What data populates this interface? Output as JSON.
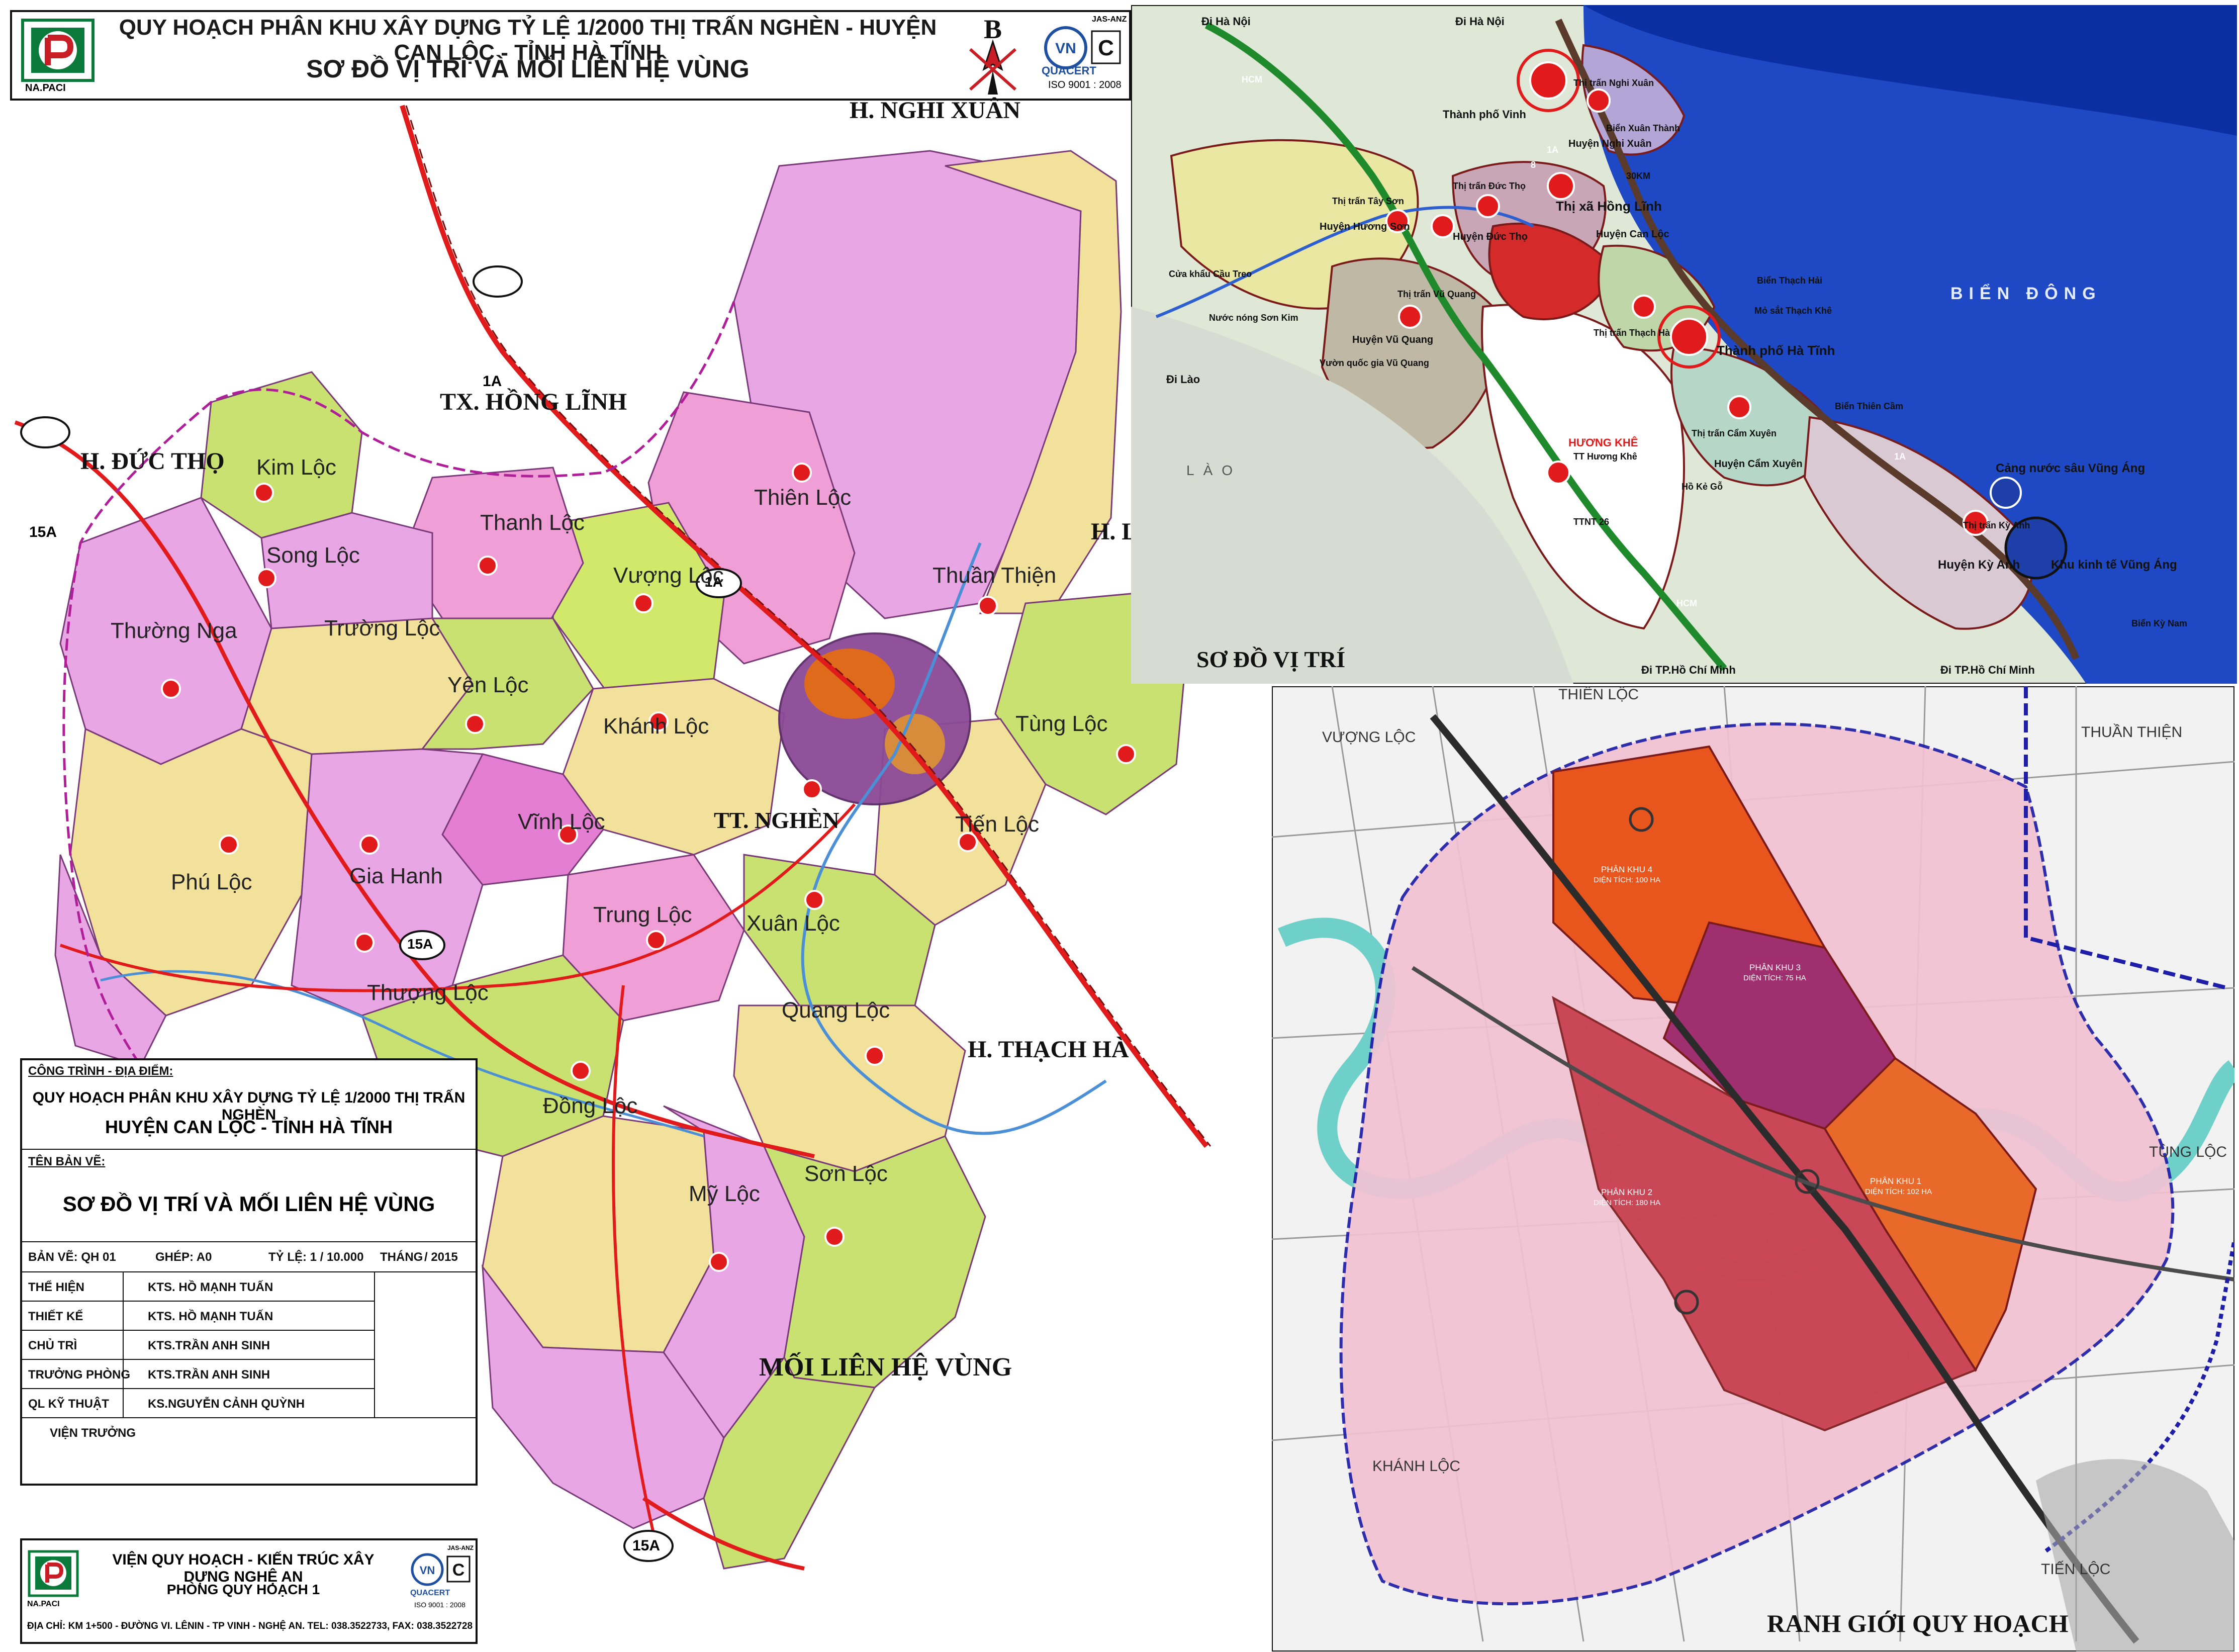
{
  "header": {
    "title_line1": "QUY HOẠCH PHÂN KHU XÂY DỰNG TỶ LỆ 1/2000 THỊ TRẤN NGHÈN - HUYỆN CAN LỘC - TỈNH HÀ TĨNH",
    "title_line2": "SƠ ĐỒ VỊ TRÍ VÀ MỐI LIÊN HỆ VÙNG",
    "logo_caption": "NA.PACI",
    "cert_label": "QUACERT",
    "cert_iso": "ISO 9001 : 2008",
    "cert_jas": "JAS-ANZ",
    "north_letter": "B"
  },
  "main_map": {
    "neighbors": [
      "H. NGHI XUÂN",
      "TX. HỒNG LĨNH",
      "H. ĐỨC THỌ",
      "H. THẠCH HÀ",
      "H. L"
    ],
    "section_title": "MỐI LIÊN HỆ VÙNG",
    "road_labels": [
      "1A",
      "1A",
      "15A",
      "15A",
      "15A"
    ],
    "communes": [
      "Kim Lộc",
      "Song Lộc",
      "Thường Nga",
      "Trường Lộc",
      "Thanh Lộc",
      "Thiên Lộc",
      "Vượng Lộc",
      "Yên Lộc",
      "Khánh Lộc",
      "Thuần Thiện",
      "Tùng Lộc",
      "Vĩnh Lộc",
      "TT. NGHÈN",
      "Tiến Lộc",
      "Phú Lộc",
      "Gia Hanh",
      "Trung Lộc",
      "Xuân Lộc",
      "Thượng Lộc",
      "Quang Lộc",
      "Đồng Lộc",
      "Mỹ Lộc",
      "Sơn Lộc"
    ]
  },
  "title_block": {
    "project_label": "CÔNG TRÌNH - ĐỊA ĐIỂM:",
    "project_line1": "QUY HOẠCH PHÂN KHU XÂY DỰNG TỶ LỆ 1/2000 THỊ TRẤN NGHÈN",
    "project_line2": "HUYỆN CAN LỘC - TỈNH HÀ TĨNH",
    "drawing_label": "TÊN BẢN VẼ:",
    "drawing_name": "SƠ ĐỒ VỊ TRÍ VÀ MỐI LIÊN HỆ VÙNG",
    "sheet": "BẢN VẼ: QH 01",
    "ghep": "GHÉP: A0",
    "scale": "TỶ LỆ: 1 / 10.000",
    "date_month": "THÁNG",
    "date_year": "/ 2015",
    "rows": [
      {
        "role": "THỂ HIỆN",
        "name": "KTS. HỒ MẠNH TUẤN"
      },
      {
        "role": "THIẾT KẾ",
        "name": "KTS. HỒ MẠNH TUẤN"
      },
      {
        "role": "CHỦ TRÌ",
        "name": "KTS.TRẦN ANH SINH"
      },
      {
        "role": "TRƯỞNG PHÒNG",
        "name": "KTS.TRẦN ANH SINH"
      },
      {
        "role": "QL KỸ THUẬT",
        "name": "KS.NGUYỄN CẢNH QUỲNH"
      }
    ],
    "director": "VIỆN TRƯỞNG"
  },
  "footer": {
    "org_line1": "VIỆN QUY HOẠCH - KIẾN TRÚC XÂY DỰNG NGHỆ AN",
    "org_line2": "PHÒNG QUY HOẠCH 1",
    "address": "ĐỊA CHỈ: KM 1+500 - ĐƯỜNG VI. LÊNIN - TP VINH - NGHỆ AN. TEL: 038.3522733, FAX: 038.3522728",
    "logo_caption": "NA.PACI",
    "cert_label": "QUACERT",
    "cert_iso": "ISO 9001 : 2008",
    "cert_jas": "JAS-ANZ"
  },
  "inset_location": {
    "title": "SƠ ĐỒ VỊ TRÍ",
    "sea_label": "BIỂN ĐÔNG",
    "laos_label": "LÀO",
    "places": [
      "Đi Hà Nội",
      "Đi Hà Nội",
      "Thành phố Vinh",
      "Thị trấn Nghi Xuân",
      "Biển Xuân Thành",
      "Huyện Nghi Xuân",
      "Thị xã Hồng Lĩnh",
      "Huyện Can Lộc",
      "Thị trấn Đức Thọ",
      "Huyện Đức Thọ",
      "Thị trấn Tây Sơn",
      "Huyện Hương Sơn",
      "Cửa khẩu Cầu Treo",
      "Nước nóng Sơn Kim",
      "Đi Lào",
      "Thị trấn Vũ Quang",
      "Huyện Vũ Quang",
      "Vườn quốc gia Vũ Quang",
      "Thị trấn Thạch Hà",
      "Thành phố Hà Tĩnh",
      "Biển Thạch Hải",
      "Mỏ sắt Thạch Khê",
      "Biển Thiên Cầm",
      "Thị trấn Cẩm Xuyên",
      "Huyện Cẩm Xuyên",
      "Hồ Kẻ Gỗ",
      "HƯƠNG KHÊ",
      "TT Hương Khê",
      "Cảng nước sâu Vũng Áng",
      "Thị trấn Kỳ Anh",
      "Huyện Kỳ Anh",
      "Khu kinh tế Vũng Áng",
      "Biển Kỳ Nam",
      "Đi TP.Hồ Chí Minh",
      "Đi TP.Hồ Chí Minh",
      "30KM",
      "TTNT 26"
    ],
    "road_labels": [
      "HCM",
      "8",
      "1A",
      "1A",
      "HCM"
    ]
  },
  "inset_plan": {
    "title": "RANH GIỚI QUY HOẠCH",
    "neighbors": [
      "THIÊN LỘC",
      "VƯỢNG LỘC",
      "THUẦN THIỆN",
      "TÙNG LỘC",
      "KHÁNH LỘC",
      "TIẾN LỘC"
    ],
    "zones": [
      {
        "name": "PHÂN KHU 4",
        "area": "DIỆN TÍCH: 100 HA"
      },
      {
        "name": "PHÂN KHU 3",
        "area": "DIỆN TÍCH: 75 HA"
      },
      {
        "name": "PHÂN KHU 2",
        "area": "DIỆN TÍCH: 180 HA"
      },
      {
        "name": "PHÂN KHU 1",
        "area": "DIỆN TÍCH: 102 HA"
      }
    ]
  }
}
